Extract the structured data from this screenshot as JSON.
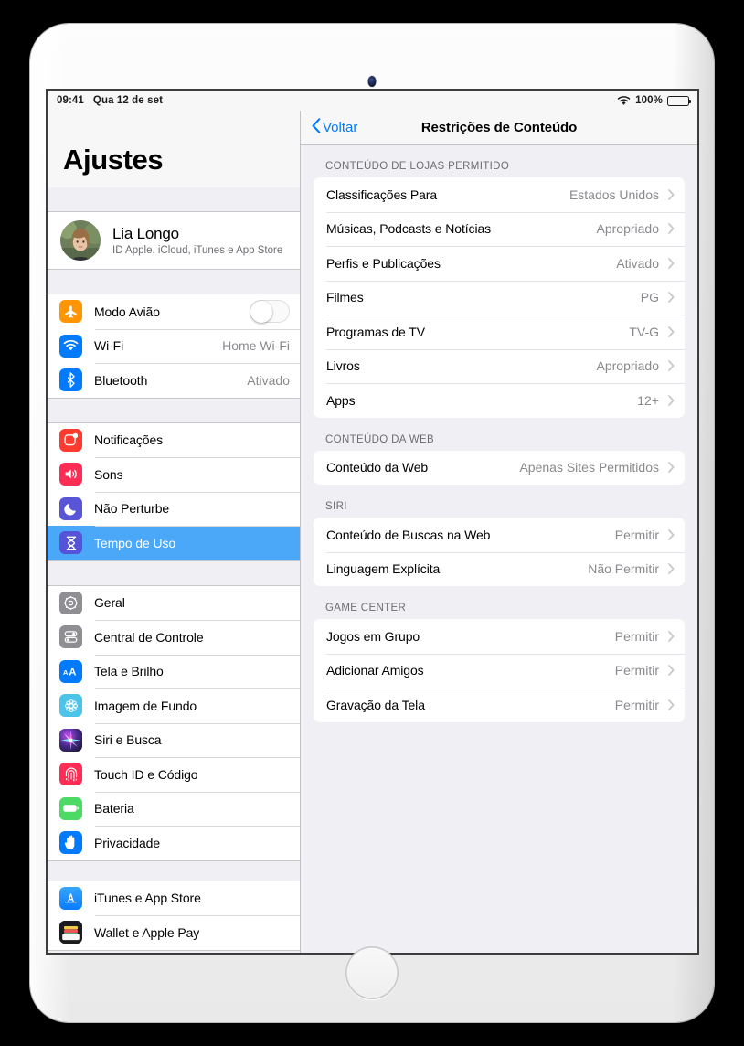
{
  "device": {
    "name": "ipad"
  },
  "status_bar": {
    "time": "09:41",
    "date": "Qua 12 de set",
    "battery_percent": "100%",
    "wifi_icon": "wifi-icon",
    "battery_icon": "battery-icon"
  },
  "sidebar": {
    "title": "Ajustes",
    "profile": {
      "name": "Lia Longo",
      "subtitle": "ID Apple, iCloud, iTunes e App Store",
      "avatar": "user-avatar"
    },
    "groups": [
      {
        "items": [
          {
            "label": "Modo Avião",
            "icon": "airplane-icon",
            "icon_class": "ic-airplane",
            "control": "toggle",
            "toggle_on": false
          },
          {
            "label": "Wi-Fi",
            "icon": "wifi-icon",
            "icon_class": "ic-wifi",
            "value": "Home Wi-Fi"
          },
          {
            "label": "Bluetooth",
            "icon": "bluetooth-icon",
            "icon_class": "ic-bt",
            "value": "Ativado"
          }
        ]
      },
      {
        "items": [
          {
            "label": "Notificações",
            "icon": "notifications-icon",
            "icon_class": "ic-notif"
          },
          {
            "label": "Sons",
            "icon": "speaker-icon",
            "icon_class": "ic-sounds"
          },
          {
            "label": "Não Perturbe",
            "icon": "moon-icon",
            "icon_class": "ic-dnd"
          },
          {
            "label": "Tempo de Uso",
            "icon": "hourglass-icon",
            "icon_class": "ic-screentime",
            "selected": true
          }
        ]
      },
      {
        "items": [
          {
            "label": "Geral",
            "icon": "gear-icon",
            "icon_class": "ic-general"
          },
          {
            "label": "Central de Controle",
            "icon": "sliders-icon",
            "icon_class": "ic-control"
          },
          {
            "label": "Tela e Brilho",
            "icon": "text-size-icon",
            "icon_class": "ic-display"
          },
          {
            "label": "Imagem de Fundo",
            "icon": "flower-icon",
            "icon_class": "ic-wallpaper"
          },
          {
            "label": "Siri e Busca",
            "icon": "siri-icon",
            "icon_class": "ic-siri"
          },
          {
            "label": "Touch ID e Código",
            "icon": "fingerprint-icon",
            "icon_class": "ic-touchid"
          },
          {
            "label": "Bateria",
            "icon": "battery-icon",
            "icon_class": "ic-battery"
          },
          {
            "label": "Privacidade",
            "icon": "hand-icon",
            "icon_class": "ic-privacy"
          }
        ]
      },
      {
        "items": [
          {
            "label": "iTunes e App Store",
            "icon": "app-store-icon",
            "icon_class": "ic-appstore"
          },
          {
            "label": "Wallet e Apple Pay",
            "icon": "wallet-icon",
            "icon_class": "ic-wallet"
          }
        ]
      }
    ]
  },
  "detail": {
    "back_label": "Voltar",
    "back_icon": "chevron-left-icon",
    "title": "Restrições de Conteúdo",
    "sections": [
      {
        "header": "CONTEÚDO DE LOJAS PERMITIDO",
        "rows": [
          {
            "label": "Classificações Para",
            "value": "Estados Unidos"
          },
          {
            "label": "Músicas, Podcasts e Notícias",
            "value": "Apropriado"
          },
          {
            "label": "Perfis e Publicações",
            "value": "Ativado"
          },
          {
            "label": "Filmes",
            "value": "PG"
          },
          {
            "label": "Programas de TV",
            "value": "TV-G"
          },
          {
            "label": "Livros",
            "value": "Apropriado"
          },
          {
            "label": "Apps",
            "value": "12+"
          }
        ]
      },
      {
        "header": "CONTEÚDO DA WEB",
        "rows": [
          {
            "label": "Conteúdo da Web",
            "value": "Apenas Sites Permitidos"
          }
        ]
      },
      {
        "header": "SIRI",
        "rows": [
          {
            "label": "Conteúdo de Buscas na Web",
            "value": "Permitir"
          },
          {
            "label": "Linguagem Explícita",
            "value": "Não Permitir"
          }
        ]
      },
      {
        "header": "GAME CENTER",
        "rows": [
          {
            "label": "Jogos em Grupo",
            "value": "Permitir"
          },
          {
            "label": "Adicionar Amigos",
            "value": "Permitir"
          },
          {
            "label": "Gravação da Tela",
            "value": "Permitir"
          }
        ]
      }
    ]
  },
  "colors": {
    "accent": "#007aff",
    "selected_row": "#4ba7f8",
    "sidebar_bg": "#efeff4",
    "value_text": "#8a8a8e"
  }
}
